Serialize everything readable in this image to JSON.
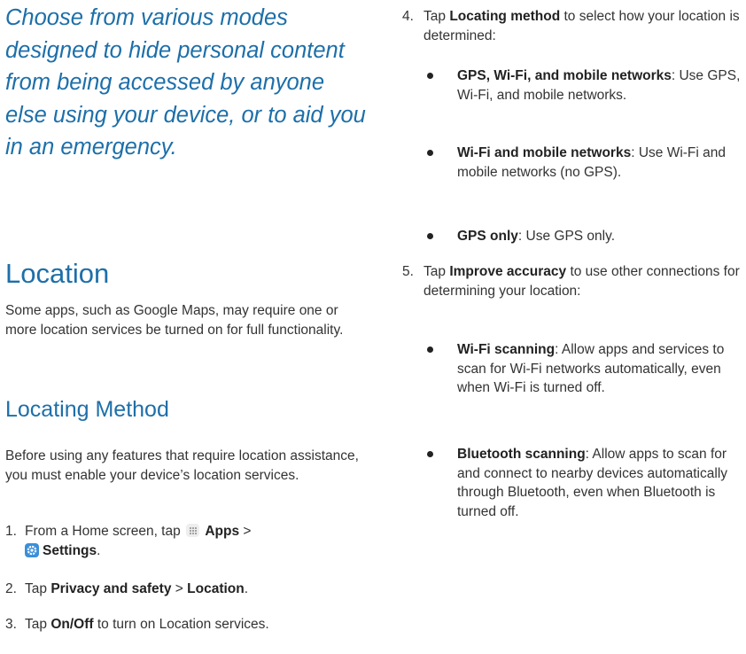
{
  "intro": "Choose from various modes designed to hide personal content from being accessed by anyone else using your device, or to aid you in an emergency.",
  "location": {
    "heading": "Location",
    "body": "Some apps, such as Google Maps, may require one or more location services be turned on for full functionality."
  },
  "method": {
    "heading": "Locating Method",
    "body": "Before using any features that require location assistance, you must enable your device’s location services."
  },
  "steps": [
    {
      "num": "1.",
      "t1": "From a Home screen, tap",
      "apps_label": "Apps",
      "sep": ">",
      "settings_label": "Settings",
      "end": "."
    },
    {
      "num": "2.",
      "t1": "Tap",
      "b1": "Privacy and safety",
      "sep": ">",
      "b2": "Location",
      "end": "."
    },
    {
      "num": "3.",
      "t1": "Tap",
      "b1": "On/Off",
      "t2": "to turn on Location services."
    },
    {
      "num": "4.",
      "t1": "Tap",
      "b1": "Locating method",
      "t2": "to select how your location is determined:"
    },
    {
      "num": "5.",
      "t1": "Tap",
      "b1": "Improve accuracy",
      "t2": "to use other connections for determining your location:"
    }
  ],
  "method_options": [
    {
      "label": "GPS, Wi-Fi, and mobile networks",
      "desc": ": Use GPS, Wi-Fi, and mobile networks."
    },
    {
      "label": "Wi-Fi and mobile networks",
      "desc": ": Use Wi-Fi and mobile networks (no GPS)."
    },
    {
      "label": "GPS only",
      "desc": ": Use GPS only."
    }
  ],
  "accuracy_options": [
    {
      "label": "Wi-Fi scanning",
      "desc": ": Allow apps and services to scan for Wi-Fi networks automatically, even when Wi-Fi is turned off."
    },
    {
      "label": "Bluetooth scanning",
      "desc": ": Allow apps to scan for and connect to nearby devices automatically through Bluetooth, even when Bluetooth is turned off."
    }
  ],
  "icons": {
    "apps": "apps-grid-icon",
    "settings": "settings-gear-icon"
  },
  "colors": {
    "heading": "#1d6fa9",
    "text": "#333333",
    "settings_icon": "#3b8fd9"
  }
}
